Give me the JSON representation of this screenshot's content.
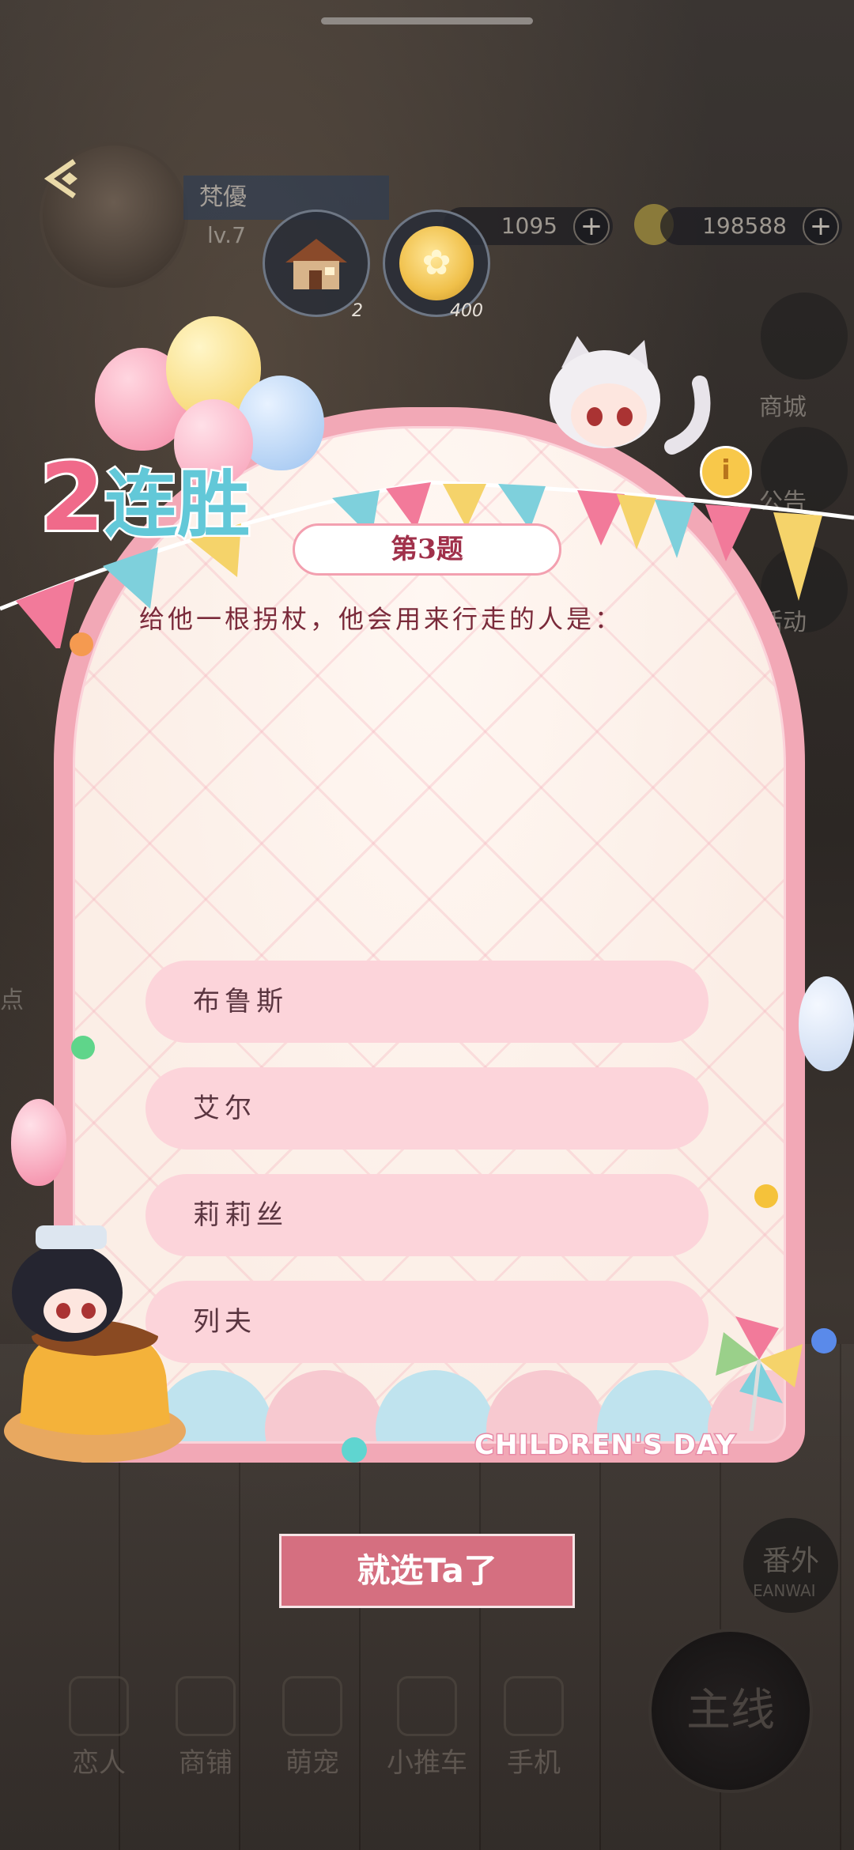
{
  "player": {
    "name": "梵優",
    "level": "lv.7"
  },
  "resources": [
    {
      "value": "1095"
    },
    {
      "value": "198588"
    }
  ],
  "items": [
    {
      "icon": "cottage-icon",
      "count": "2"
    },
    {
      "icon": "gold-coin-icon",
      "count": "400"
    }
  ],
  "side_menu": {
    "shop": "商城",
    "announce": "公告",
    "activity": "活动"
  },
  "streak": {
    "count": "2",
    "label": "连胜"
  },
  "quiz": {
    "number_label": "第3题",
    "question": "给他一根拐杖，他会用来行走的人是：",
    "options": [
      "布鲁斯",
      "艾尔",
      "莉莉丝",
      "列夫"
    ],
    "submit_label": "就选Ta了"
  },
  "event_label": "CHILDREN'S DAY",
  "left_hint": "点",
  "fanwai": {
    "label": "番外",
    "sub": "EANWAI"
  },
  "bottom_nav": [
    {
      "label": "恋人"
    },
    {
      "label": "商铺"
    },
    {
      "label": "萌宠"
    },
    {
      "label": "小推车"
    },
    {
      "label": "手机"
    }
  ],
  "main_button_label": "主线",
  "colors": {
    "card_border": "#f2a8b6",
    "option_bg": "#fcd4da",
    "submit_bg": "#d56f80",
    "question_text": "#7a2a3a"
  }
}
